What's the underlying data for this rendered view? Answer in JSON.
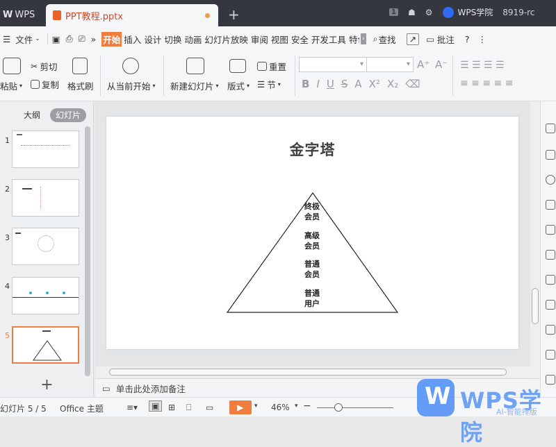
{
  "titlebar": {
    "app_tab": "WPS",
    "doc_tab": "PPT教程.pptx",
    "new_tab": "+",
    "badge": "1",
    "wps_academy": "WPS学院",
    "user_id": "8919-rc"
  },
  "menu": {
    "file": "文件",
    "items": [
      "开始",
      "插入",
      "设计",
      "切换",
      "动画",
      "幻灯片放映",
      "审阅",
      "视图",
      "安全",
      "开发工具",
      "特色"
    ],
    "active": "开始",
    "search": "查找",
    "comment": "批注",
    "help": "?"
  },
  "ribbon": {
    "paste": "粘贴",
    "cut": "剪切",
    "copy": "复制",
    "format_painter": "格式刷",
    "play_from_current": "从当前开始",
    "new_slide": "新建幻灯片",
    "layout": "版式",
    "reset": "重置",
    "section": "节",
    "font_icons": [
      "B",
      "I",
      "U",
      "S",
      "A",
      "X²",
      "X₂",
      "⌫"
    ],
    "grow_icons": [
      "A⁺",
      "A⁻"
    ]
  },
  "left_panel": {
    "tab_outline": "大纲",
    "tab_slides": "幻灯片",
    "slide_numbers": [
      "1",
      "2",
      "3",
      "4",
      "5"
    ],
    "selected_slide": 5,
    "add_slide": "+"
  },
  "slide": {
    "title": "金字塔",
    "levels": [
      [
        "终极",
        "会员"
      ],
      [
        "高级",
        "会员"
      ],
      [
        "普通",
        "会员"
      ],
      [
        "普通",
        "用户"
      ]
    ]
  },
  "notes": {
    "placeholder": "单击此处添加备注"
  },
  "status": {
    "slide_counter": "幻灯片 5 / 5",
    "theme": "Office 主题",
    "zoom": "46%",
    "zoom_minus": "−",
    "zoom_plus": "+"
  },
  "watermark": {
    "brand": "WPS学院",
    "sub": "AI-智能排版"
  },
  "colors": {
    "accent": "#f07d3e",
    "titlebar": "#34373e"
  }
}
